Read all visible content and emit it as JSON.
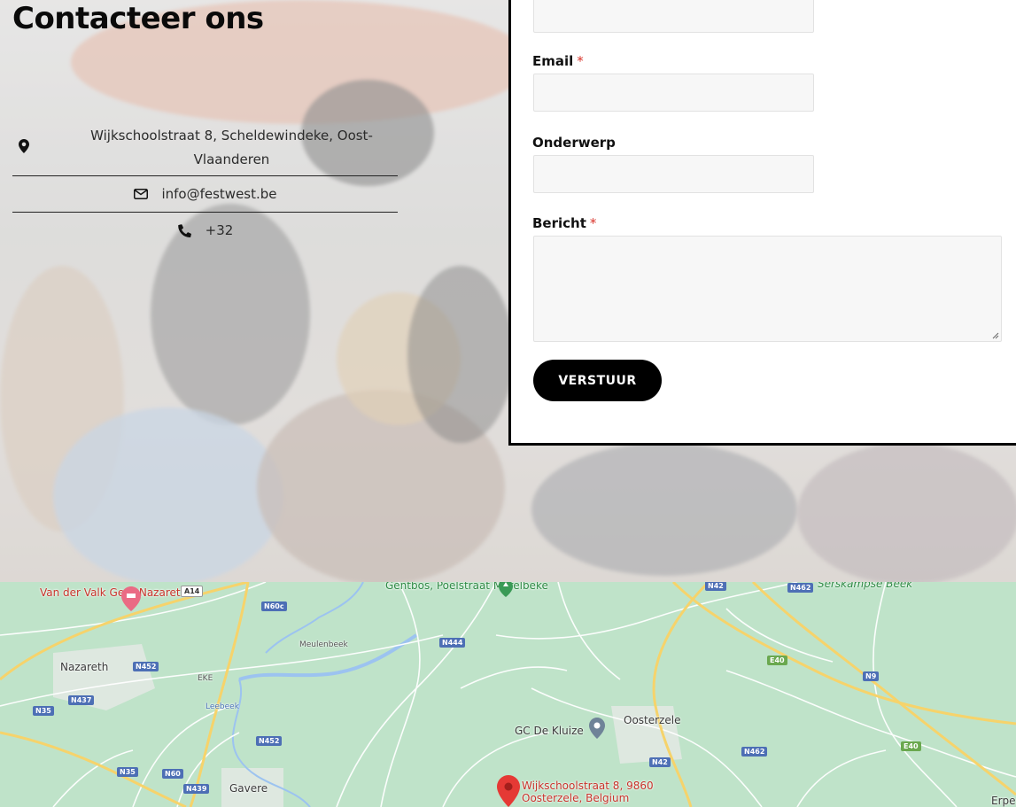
{
  "header": {
    "title": "Contacteer ons"
  },
  "contact": {
    "address": "Wijkschoolstraat 8, Scheldewindeke, Oost-Vlaanderen",
    "email": "info@festwest.be",
    "phone": "+32"
  },
  "form": {
    "email_label": "Email",
    "subject_label": "Onderwerp",
    "message_label": "Bericht",
    "required_mark": "*",
    "submit_label": "VERSTUUR"
  },
  "map": {
    "places": {
      "hotel": "Van der Valk Gent-Nazareth",
      "gentbos": "Gentbos, Poelstraat Merelbeke",
      "serskampse": "Serskampse Beek",
      "nazareth": "Nazareth",
      "meulenbeek": "Meulenbeek",
      "eke": "EKE",
      "leebeek": "Leebeek",
      "gavere": "Gavere",
      "oosterzele": "Oosterzele",
      "kluize": "GC De Kluize",
      "pin": "Wijkschoolstraat 8, 9860 Oosterzele, Belgium",
      "erpe": "Erpe"
    },
    "roads": {
      "a14": "A14",
      "n60c": "N60c",
      "n42a": "N42",
      "n462a": "N462",
      "n444": "N444",
      "e40a": "E40",
      "n9": "N9",
      "n452a": "N452",
      "n437": "N437",
      "n35a": "N35",
      "n452b": "N452",
      "n42b": "N42",
      "n462b": "N462",
      "e40b": "E40",
      "n35b": "N35",
      "n60": "N60",
      "n439": "N439"
    },
    "colors": {
      "land": "#bfe3c9",
      "road": "#ffffff",
      "highway": "#f6d36b",
      "water": "#9cc3f0",
      "pin": "#e53935"
    }
  }
}
